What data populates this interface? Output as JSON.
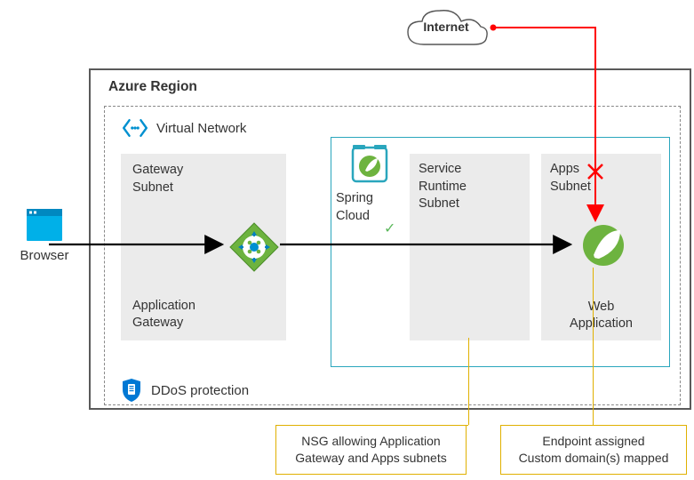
{
  "internet_label": "Internet",
  "region_title": "Azure Region",
  "vnet_label": "Virtual Network",
  "gateway_subnet": {
    "line1": "Gateway",
    "line2": "Subnet",
    "line3": "Application",
    "line4": "Gateway"
  },
  "spring_cloud": {
    "line1": "Spring",
    "line2": "Cloud"
  },
  "service_runtime_subnet": {
    "line1": "Service",
    "line2": "Runtime",
    "line3": "Subnet"
  },
  "apps_subnet": {
    "line1": "Apps",
    "line2": "Subnet",
    "line3": "Web",
    "line4": "Application"
  },
  "ddos_label": "DDoS protection",
  "browser_label": "Browser",
  "callout_nsg": {
    "line1": "NSG allowing Application",
    "line2": "Gateway and Apps subnets"
  },
  "callout_endpoint": {
    "line1": "Endpoint assigned",
    "line2": "Custom domain(s) mapped"
  },
  "colors": {
    "region_border": "#5a5a5a",
    "teal_border": "#2aa6bd",
    "callout_border": "#e0b000",
    "blocked_arrow": "#ff0000",
    "allowed_arrow": "#000000",
    "check": "#5cb85c"
  }
}
